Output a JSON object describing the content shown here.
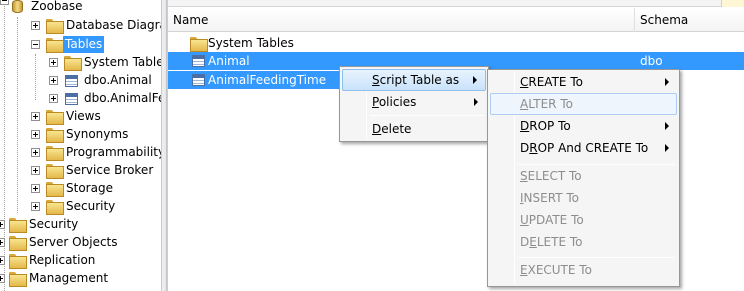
{
  "tree": {
    "items": [
      {
        "label": "Zoobase",
        "icon": "database-icon"
      },
      {
        "label": "Database Diagrams",
        "icon": "folder-icon"
      },
      {
        "label": "Tables",
        "icon": "folder-icon",
        "selected": true
      },
      {
        "label": "System Tables",
        "icon": "folder-icon"
      },
      {
        "label": "dbo.Animal",
        "icon": "table-icon"
      },
      {
        "label": "dbo.AnimalFeedingTime",
        "icon": "table-icon"
      },
      {
        "label": "Views",
        "icon": "folder-icon"
      },
      {
        "label": "Synonyms",
        "icon": "folder-icon"
      },
      {
        "label": "Programmability",
        "icon": "folder-icon"
      },
      {
        "label": "Service Broker",
        "icon": "folder-icon"
      },
      {
        "label": "Storage",
        "icon": "folder-icon"
      },
      {
        "label": "Security",
        "icon": "folder-icon"
      },
      {
        "label": "Security",
        "icon": "folder-icon"
      },
      {
        "label": "Server Objects",
        "icon": "folder-icon"
      },
      {
        "label": "Replication",
        "icon": "folder-icon"
      },
      {
        "label": "Management",
        "icon": "folder-icon"
      }
    ]
  },
  "list": {
    "columns": [
      "Name",
      "Schema"
    ],
    "rows": [
      {
        "name": "System Tables",
        "schema": "",
        "icon": "folder-icon"
      },
      {
        "name": "Animal",
        "schema": "dbo",
        "icon": "table-icon",
        "selected": true
      },
      {
        "name": "AnimalFeedingTime",
        "schema": "",
        "icon": "table-icon",
        "selected": true
      }
    ]
  },
  "context_menu": {
    "items": [
      {
        "pre": "",
        "key": "S",
        "post": "cript Table as",
        "submenu": true,
        "active": true
      },
      {
        "pre": "",
        "key": "P",
        "post": "olicies",
        "submenu": true
      },
      {
        "pre": "",
        "key": "D",
        "post": "elete",
        "submenu": false
      }
    ]
  },
  "submenu": {
    "items": [
      {
        "pre": "",
        "key": "C",
        "post": "REATE To",
        "submenu": true,
        "disabled": false
      },
      {
        "pre": "",
        "key": "A",
        "post": "LTER To",
        "submenu": false,
        "disabled": true,
        "hot": true
      },
      {
        "pre": "",
        "key": "D",
        "post": "ROP To",
        "submenu": true,
        "disabled": false
      },
      {
        "pre": "D",
        "key": "R",
        "post": "OP And CREATE To",
        "submenu": true,
        "disabled": false
      },
      {
        "pre": "",
        "key": "S",
        "post": "ELECT To",
        "submenu": false,
        "disabled": true
      },
      {
        "pre": "",
        "key": "I",
        "post": "NSERT To",
        "submenu": false,
        "disabled": true
      },
      {
        "pre": "",
        "key": "U",
        "post": "PDATE To",
        "submenu": false,
        "disabled": true
      },
      {
        "pre": "D",
        "key": "E",
        "post": "LETE To",
        "submenu": false,
        "disabled": true
      },
      {
        "pre": "",
        "key": "E",
        "post": "XECUTE To",
        "submenu": false,
        "disabled": true
      }
    ]
  },
  "colors": {
    "selection": "#3399ff",
    "menu_bg": "#f5f5f5",
    "menu_highlight": "#c9e3fb",
    "disabled_text": "#8d8d8d"
  }
}
